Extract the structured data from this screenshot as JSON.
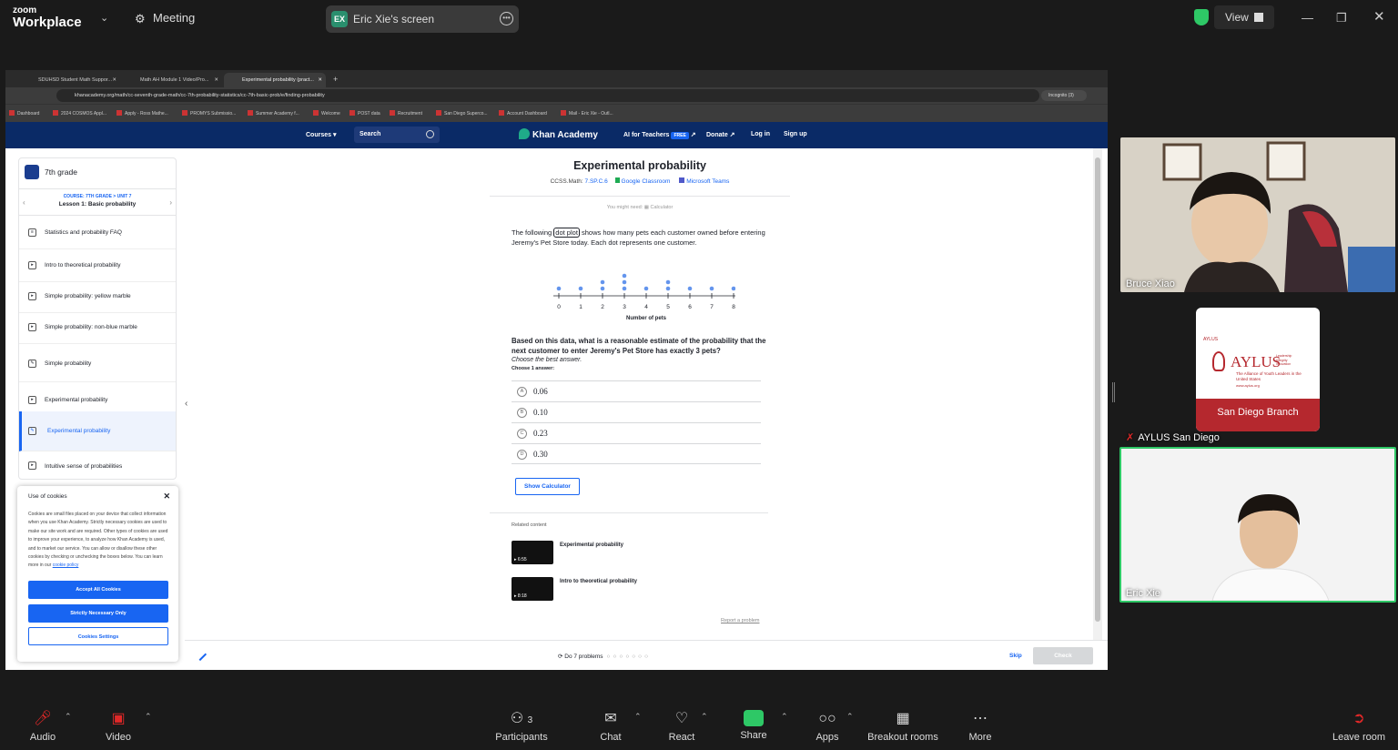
{
  "zoom": {
    "logo_small": "zoom",
    "logo_big": "Workplace",
    "meeting_label": "Meeting",
    "share_initials": "EX",
    "share_label": "Eric Xie's screen",
    "view_label": "View",
    "bottom": {
      "audio": "Audio",
      "video": "Video",
      "participants": "Participants",
      "participants_count": "3",
      "chat": "Chat",
      "react": "React",
      "share": "Share",
      "apps": "Apps",
      "breakout": "Breakout rooms",
      "more": "More",
      "leave": "Leave room"
    },
    "participants": [
      {
        "name": "Bruce Xiao"
      },
      {
        "name": "AYLUS San Diego"
      },
      {
        "name": "Eric Xie"
      }
    ],
    "aylus_card": {
      "small": "AYLUS",
      "big": "AYLUS",
      "tag1": "Leadership",
      "tag2": "Integrity",
      "tag3": "Innovation",
      "subtitle": "The Alliance of Youth Leaders in the United States",
      "site": "www.aylus.org",
      "branch": "San Diego Branch"
    }
  },
  "browser": {
    "tabs": [
      {
        "label": "SDUHSD Student Math Suppor..."
      },
      {
        "label": "Math AH Module 1 Video/Pro..."
      },
      {
        "label": "Experimental probability (pract..."
      }
    ],
    "url": "khanacademy.org/math/cc-seventh-grade-math/cc-7th-probability-statistics/cc-7th-basic-prob/e/finding-probability",
    "incognito": "Incognito (3)",
    "bookmarks": [
      "Dashboard",
      "2024 COSMOS Appl...",
      "Apply - Ross Mathe...",
      "PROMYS Submissio...",
      "Summer Academy f...",
      "Welcome",
      "POST data",
      "Recruitment",
      "San Diego Superco...",
      "Account Dashboard",
      "Mail - Eric Xie - Outl..."
    ]
  },
  "ka": {
    "nav": {
      "courses": "Courses",
      "search": "Search",
      "logo": "Khan Academy",
      "ai": "AI for Teachers",
      "free": "FREE",
      "donate": "Donate",
      "login": "Log in",
      "signup": "Sign up"
    },
    "sidebar": {
      "grade": "7th grade",
      "course_line": "COURSE: 7TH GRADE > UNIT 7",
      "lesson": "Lesson 1: Basic probability",
      "items": [
        {
          "label": "Statistics and probability FAQ",
          "icon": "article-icon"
        },
        {
          "label": "Intro to theoretical probability",
          "icon": "video-icon"
        },
        {
          "label": "Simple probability: yellow marble",
          "icon": "video-icon"
        },
        {
          "label": "Simple probability: non-blue marble",
          "icon": "video-icon"
        },
        {
          "label": "Simple probability",
          "icon": "exercise-icon"
        },
        {
          "label": "Experimental probability",
          "icon": "video-icon"
        },
        {
          "label": "Experimental probability",
          "icon": "exercise-icon"
        },
        {
          "label": "Intuitive sense of probabilities",
          "icon": "video-icon"
        }
      ]
    },
    "cookie": {
      "title": "Use of cookies",
      "body": "Cookies are small files placed on your device that collect information when you use Khan Academy. Strictly necessary cookies are used to make our site work and are required. Other types of cookies are used to improve your experience, to analyze how Khan Academy is used, and to market our service. You can allow or disallow these other cookies by checking or unchecking the boxes below. You can learn more in our",
      "link": "cookie policy",
      "accept": "Accept All Cookies",
      "necessary": "Strictly Necessary Only",
      "settings": "Cookies Settings"
    },
    "exercise": {
      "title": "Experimental probability",
      "standard_prefix": "CCSS.Math:",
      "standard": "7.SP.C.6",
      "google": "Google Classroom",
      "teams": "Microsoft Teams",
      "need": "You might need:",
      "need_tool": "Calculator",
      "prompt_a": "The following",
      "prompt_hl": "dot plot",
      "prompt_b": "shows how many pets each customer owned before entering Jeremy's Pet Store today. Each dot represents one customer.",
      "question": "Based on this data, what is a reasonable estimate of the probability that the next customer to enter Jeremy's Pet Store has exactly 3 pets?",
      "choose_best": "Choose the best answer.",
      "choose_one": "Choose 1 answer:",
      "choices": [
        {
          "letter": "A",
          "value": "0.06"
        },
        {
          "letter": "B",
          "value": "0.10"
        },
        {
          "letter": "C",
          "value": "0.23"
        },
        {
          "letter": "D",
          "value": "0.30"
        }
      ],
      "calculator": "Show Calculator",
      "related": "Related content",
      "related_items": [
        {
          "title": "Experimental probability",
          "duration": "6:55"
        },
        {
          "title": "Intro to theoretical probability",
          "duration": "8:18"
        }
      ],
      "report": "Report a problem"
    },
    "footer": {
      "do": "Do 7 problems",
      "skip": "Skip",
      "check": "Check"
    }
  },
  "chart_data": {
    "type": "scatter",
    "xlabel": "Number of pets",
    "x": [
      0,
      1,
      2,
      3,
      4,
      5,
      6,
      7,
      8
    ],
    "counts": [
      1,
      1,
      2,
      3,
      1,
      2,
      1,
      1,
      1
    ],
    "ticks": [
      "0",
      "1",
      "2",
      "3",
      "4",
      "5",
      "6",
      "7",
      "8"
    ],
    "color": "#6495ed"
  }
}
